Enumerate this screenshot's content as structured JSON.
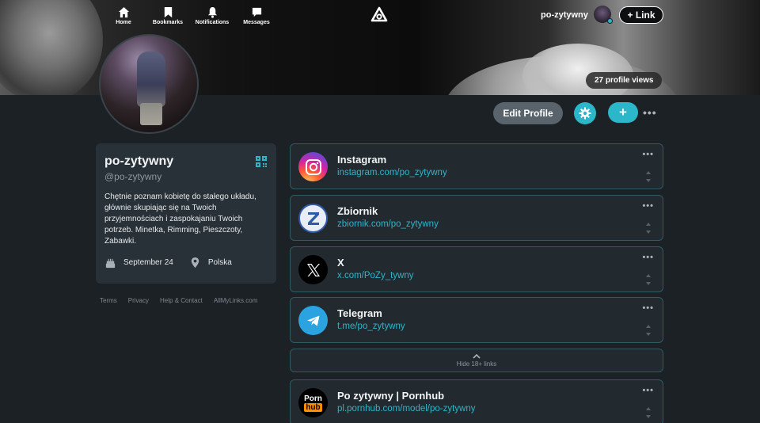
{
  "nav": {
    "items": [
      {
        "label": "Home",
        "icon": "home-icon"
      },
      {
        "label": "Bookmarks",
        "icon": "bookmark-icon"
      },
      {
        "label": "Notifications",
        "icon": "bell-icon"
      },
      {
        "label": "Messages",
        "icon": "message-icon"
      }
    ],
    "username": "po-zytywny",
    "link_button": "+ Link"
  },
  "banner": {
    "profile_views": "27 profile views"
  },
  "actions": {
    "edit_profile": "Edit Profile",
    "add": "+",
    "more": "•••"
  },
  "profile": {
    "name": "po-zytywny",
    "handle": "@po-zytywny",
    "bio": "Chętnie poznam kobietę do stałego układu, głównie skupiając się na Twoich przyjemnościach i zaspokajaniu Twoich potrzeb. Minetka, Rimming, Pieszczoty, Zabawki.",
    "birthday": "September 24",
    "location": "Polska"
  },
  "footer": [
    "Terms",
    "Privacy",
    "Help & Contact",
    "AllMyLinks.com"
  ],
  "links": [
    {
      "title": "Instagram",
      "url": "instagram.com/po_zytywny",
      "icon": "instagram-icon"
    },
    {
      "title": "Zbiornik",
      "url": "zbiornik.com/po_zytywny",
      "icon": "zbiornik-icon"
    },
    {
      "title": "X",
      "url": "x.com/PoZy_tywny",
      "icon": "x-icon"
    },
    {
      "title": "Telegram",
      "url": "t.me/po_zytywny",
      "icon": "telegram-icon"
    }
  ],
  "hide_adult": "Hide 18+ links",
  "adult_links": [
    {
      "title": "Po zytywny | Pornhub",
      "url": "pl.pornhub.com/model/po-zytywny",
      "icon": "pornhub-icon",
      "icon_text_top": "Porn",
      "icon_text_bottom": "hub"
    }
  ],
  "colors": {
    "accent": "#2bb6c9",
    "background": "#1c2126",
    "card": "#293138"
  }
}
